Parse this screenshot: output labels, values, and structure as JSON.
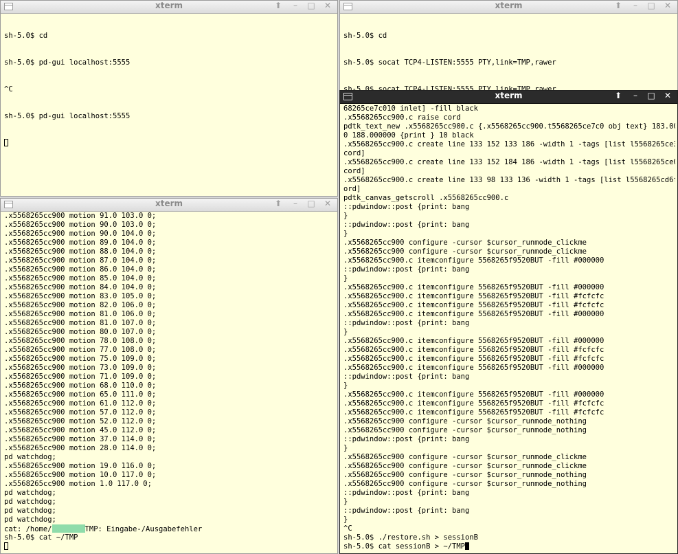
{
  "windows": {
    "top_left": {
      "title": "xterm",
      "buttons": {
        "up": "⬆",
        "min": "–",
        "max": "□",
        "close": "✕"
      },
      "lines": [
        "sh-5.0$ cd",
        "sh-5.0$ pd-gui localhost:5555",
        "^C",
        "sh-5.0$ pd-gui localhost:5555"
      ]
    },
    "top_right": {
      "title": "xterm",
      "buttons": {
        "up": "⬆",
        "min": "–",
        "max": "□",
        "close": "✕"
      },
      "lines": [
        "sh-5.0$ cd",
        "sh-5.0$ socat TCP4-LISTEN:5555 PTY,link=TMP,rawer",
        "sh-5.0$ socat TCP4-LISTEN:5555 PTY,link=TMP,rawer"
      ]
    },
    "bottom_left": {
      "title": "xterm",
      "buttons": {
        "up": "⬆",
        "min": "–",
        "max": "□",
        "close": "✕"
      },
      "lines": [
        ".x5568265cc900 motion 91.0 103.0 0;",
        ".x5568265cc900 motion 90.0 103.0 0;",
        ".x5568265cc900 motion 90.0 104.0 0;",
        ".x5568265cc900 motion 89.0 104.0 0;",
        ".x5568265cc900 motion 88.0 104.0 0;",
        ".x5568265cc900 motion 87.0 104.0 0;",
        ".x5568265cc900 motion 86.0 104.0 0;",
        ".x5568265cc900 motion 85.0 104.0 0;",
        ".x5568265cc900 motion 84.0 104.0 0;",
        ".x5568265cc900 motion 83.0 105.0 0;",
        ".x5568265cc900 motion 82.0 106.0 0;",
        ".x5568265cc900 motion 81.0 106.0 0;",
        ".x5568265cc900 motion 81.0 107.0 0;",
        ".x5568265cc900 motion 80.0 107.0 0;",
        ".x5568265cc900 motion 78.0 108.0 0;",
        ".x5568265cc900 motion 77.0 108.0 0;",
        ".x5568265cc900 motion 75.0 109.0 0;",
        ".x5568265cc900 motion 73.0 109.0 0;",
        ".x5568265cc900 motion 71.0 109.0 0;",
        ".x5568265cc900 motion 68.0 110.0 0;",
        ".x5568265cc900 motion 65.0 111.0 0;",
        ".x5568265cc900 motion 61.0 112.0 0;",
        ".x5568265cc900 motion 57.0 112.0 0;",
        ".x5568265cc900 motion 52.0 112.0 0;",
        ".x5568265cc900 motion 45.0 112.0 0;",
        ".x5568265cc900 motion 37.0 114.0 0;",
        ".x5568265cc900 motion 28.0 114.0 0;",
        "pd watchdog;",
        ".x5568265cc900 motion 19.0 116.0 0;",
        ".x5568265cc900 motion 10.0 117.0 0;",
        ".x5568265cc900 motion 1.0 117.0 0;",
        "pd watchdog;",
        "pd watchdog;",
        "pd watchdog;",
        "pd watchdog;"
      ],
      "error_line": {
        "prefix": "cat: /home/",
        "suffix": "TMP: Eingabe-/Ausgabefehler"
      },
      "prompt_line": "sh-5.0$ cat ~/TMP"
    },
    "right_active": {
      "title": "xterm",
      "buttons": {
        "up": "⬆",
        "min": "–",
        "max": "□",
        "close": "✕"
      },
      "lines": [
        "68265ce7c010 inlet] -fill black",
        ".x5568265cc900.c raise cord",
        "pdtk_text_new .x5568265cc900.c {.x5568265cc900.t5568265ce7c0 obj text} 183.00000",
        "0 188.000000 {print } 10 black",
        ".x5568265cc900.c create line 133 152 133 186 -width 1 -tags [list l5568265ce3b0",
        "cord]",
        ".x5568265cc900.c create line 133 152 184 186 -width 1 -tags [list l5568265ce0e0",
        "cord]",
        ".x5568265cc900.c create line 133 98 133 136 -width 1 -tags [list l5568265cd6f0 c",
        "ord]",
        "pdtk_canvas_getscroll .x5568265cc900.c",
        "::pdwindow::post {print: bang",
        "}",
        "::pdwindow::post {print: bang",
        "}",
        ".x5568265cc900 configure -cursor $cursor_runmode_clickme",
        ".x5568265cc900 configure -cursor $cursor_runmode_clickme",
        ".x5568265cc900.c itemconfigure 5568265f9520BUT -fill #000000",
        "::pdwindow::post {print: bang",
        "}",
        ".x5568265cc900.c itemconfigure 5568265f9520BUT -fill #000000",
        ".x5568265cc900.c itemconfigure 5568265f9520BUT -fill #fcfcfc",
        ".x5568265cc900.c itemconfigure 5568265f9520BUT -fill #fcfcfc",
        ".x5568265cc900.c itemconfigure 5568265f9520BUT -fill #000000",
        "::pdwindow::post {print: bang",
        "}",
        ".x5568265cc900.c itemconfigure 5568265f9520BUT -fill #000000",
        ".x5568265cc900.c itemconfigure 5568265f9520BUT -fill #fcfcfc",
        ".x5568265cc900.c itemconfigure 5568265f9520BUT -fill #fcfcfc",
        ".x5568265cc900.c itemconfigure 5568265f9520BUT -fill #000000",
        "::pdwindow::post {print: bang",
        "}",
        ".x5568265cc900.c itemconfigure 5568265f9520BUT -fill #000000",
        ".x5568265cc900.c itemconfigure 5568265f9520BUT -fill #fcfcfc",
        ".x5568265cc900.c itemconfigure 5568265f9520BUT -fill #fcfcfc",
        ".x5568265cc900 configure -cursor $cursor_runmode_nothing",
        ".x5568265cc900 configure -cursor $cursor_runmode_nothing",
        "::pdwindow::post {print: bang",
        "}",
        ".x5568265cc900 configure -cursor $cursor_runmode_clickme",
        ".x5568265cc900 configure -cursor $cursor_runmode_clickme",
        ".x5568265cc900 configure -cursor $cursor_runmode_nothing",
        ".x5568265cc900 configure -cursor $cursor_runmode_nothing",
        "::pdwindow::post {print: bang",
        "}",
        "::pdwindow::post {print: bang",
        "}",
        "^C",
        "sh-5.0$ ./restore.sh > sessionB"
      ],
      "prompt_line": "sh-5.0$ cat sessionB > ~/TMP"
    }
  }
}
